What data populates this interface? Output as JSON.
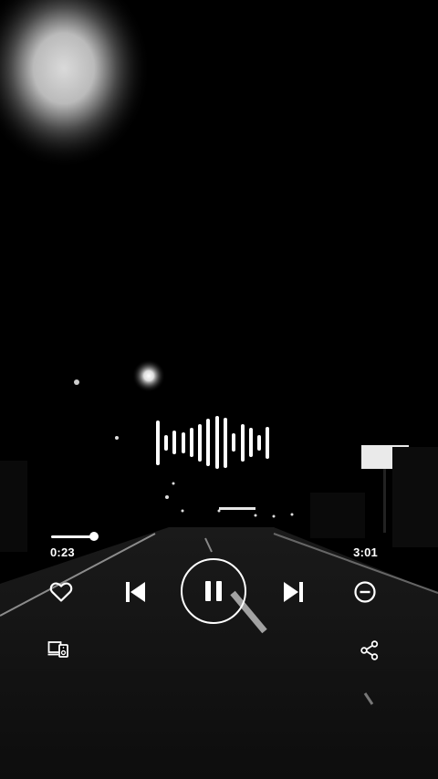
{
  "player": {
    "elapsed_time": "0:23",
    "total_time": "3:01",
    "progress_fraction": 0.127,
    "state": "playing"
  },
  "waveform": {
    "levels": [
      0.85,
      0.3,
      0.45,
      0.4,
      0.55,
      0.7,
      0.9,
      1.0,
      0.95,
      0.35,
      0.7,
      0.55,
      0.3,
      0.6
    ]
  },
  "controls": {
    "like_icon": "heart-outline-icon",
    "previous_icon": "skip-previous-icon",
    "play_pause_icon": "pause-icon",
    "next_icon": "skip-next-icon",
    "remove_icon": "minus-circle-icon",
    "devices_icon": "connect-device-icon",
    "share_icon": "share-icon"
  },
  "colors": {
    "foreground": "#ffffff",
    "background": "#000000"
  }
}
